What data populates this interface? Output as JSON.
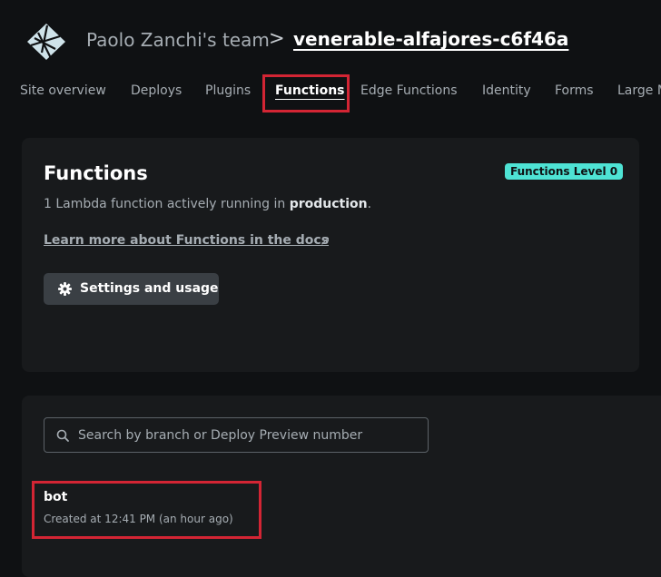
{
  "header": {
    "team_name": "Paolo Zanchi's team",
    "separator": ">",
    "site_name": "venerable-alfajores-c6f46a",
    "logo_icon": "netlify-logo-icon"
  },
  "tabs": [
    {
      "label": "Site overview",
      "active": false
    },
    {
      "label": "Deploys",
      "active": false
    },
    {
      "label": "Plugins",
      "active": false
    },
    {
      "label": "Functions",
      "active": true
    },
    {
      "label": "Edge Functions",
      "active": false
    },
    {
      "label": "Identity",
      "active": false
    },
    {
      "label": "Forms",
      "active": false
    },
    {
      "label": "Large Media",
      "active": false
    }
  ],
  "functions_card": {
    "title": "Functions",
    "badge": "Functions Level 0",
    "description_prefix": "1 Lambda function actively running in ",
    "description_emphasis": "production",
    "description_suffix": ".",
    "docs_link": "Learn more about Functions in the docs",
    "docs_link_icon": "external-link-icon",
    "settings_button": "Settings and usage",
    "settings_icon": "gear-icon"
  },
  "list_card": {
    "search_placeholder": "Search by branch or Deploy Preview number",
    "search_value": "",
    "functions": [
      {
        "name": "bot",
        "created": "Created at 12:41 PM (an hour ago)"
      }
    ]
  },
  "colors": {
    "background": "#0f1113",
    "card": "#181a1c",
    "badge": "#4ee3d4",
    "highlight": "#d32534",
    "button": "#3a3f44"
  }
}
